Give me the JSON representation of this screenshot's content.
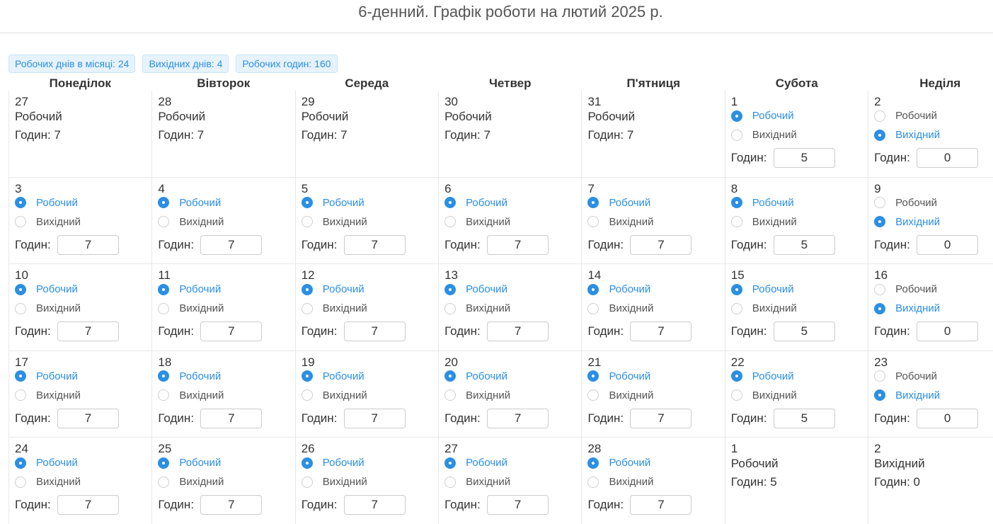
{
  "title": "6-денний. Графік роботи на лютий 2025 р.",
  "badges": [
    {
      "label": "Робочих днів в місяці: 24"
    },
    {
      "label": "Вихідних днів: 4"
    },
    {
      "label": "Робочих годин: 160"
    }
  ],
  "weekdays": [
    "Понеділок",
    "Вівторок",
    "Середа",
    "Четвер",
    "П'ятниця",
    "Субота",
    "Неділя"
  ],
  "labels": {
    "work": "Робочий",
    "off": "Вихідний",
    "hours": "Годин:"
  },
  "weeks": [
    [
      {
        "day": "27",
        "static": true,
        "type": "Робочий",
        "hours_text": "Годин: 7"
      },
      {
        "day": "28",
        "static": true,
        "type": "Робочий",
        "hours_text": "Годин: 7"
      },
      {
        "day": "29",
        "static": true,
        "type": "Робочий",
        "hours_text": "Годин: 7"
      },
      {
        "day": "30",
        "static": true,
        "type": "Робочий",
        "hours_text": "Годин: 7"
      },
      {
        "day": "31",
        "static": true,
        "type": "Робочий",
        "hours_text": "Годин: 7"
      },
      {
        "day": "1",
        "static": false,
        "working": true,
        "hours": "5"
      },
      {
        "day": "2",
        "static": false,
        "working": false,
        "hours": "0"
      }
    ],
    [
      {
        "day": "3",
        "static": false,
        "working": true,
        "hours": "7"
      },
      {
        "day": "4",
        "static": false,
        "working": true,
        "hours": "7"
      },
      {
        "day": "5",
        "static": false,
        "working": true,
        "hours": "7"
      },
      {
        "day": "6",
        "static": false,
        "working": true,
        "hours": "7"
      },
      {
        "day": "7",
        "static": false,
        "working": true,
        "hours": "7"
      },
      {
        "day": "8",
        "static": false,
        "working": true,
        "hours": "5"
      },
      {
        "day": "9",
        "static": false,
        "working": false,
        "hours": "0"
      }
    ],
    [
      {
        "day": "10",
        "static": false,
        "working": true,
        "hours": "7"
      },
      {
        "day": "11",
        "static": false,
        "working": true,
        "hours": "7"
      },
      {
        "day": "12",
        "static": false,
        "working": true,
        "hours": "7"
      },
      {
        "day": "13",
        "static": false,
        "working": true,
        "hours": "7"
      },
      {
        "day": "14",
        "static": false,
        "working": true,
        "hours": "7"
      },
      {
        "day": "15",
        "static": false,
        "working": true,
        "hours": "5"
      },
      {
        "day": "16",
        "static": false,
        "working": false,
        "hours": "0"
      }
    ],
    [
      {
        "day": "17",
        "static": false,
        "working": true,
        "hours": "7"
      },
      {
        "day": "18",
        "static": false,
        "working": true,
        "hours": "7"
      },
      {
        "day": "19",
        "static": false,
        "working": true,
        "hours": "7"
      },
      {
        "day": "20",
        "static": false,
        "working": true,
        "hours": "7"
      },
      {
        "day": "21",
        "static": false,
        "working": true,
        "hours": "7"
      },
      {
        "day": "22",
        "static": false,
        "working": true,
        "hours": "5"
      },
      {
        "day": "23",
        "static": false,
        "working": false,
        "hours": "0"
      }
    ],
    [
      {
        "day": "24",
        "static": false,
        "working": true,
        "hours": "7"
      },
      {
        "day": "25",
        "static": false,
        "working": true,
        "hours": "7"
      },
      {
        "day": "26",
        "static": false,
        "working": true,
        "hours": "7"
      },
      {
        "day": "27",
        "static": false,
        "working": true,
        "hours": "7"
      },
      {
        "day": "28",
        "static": false,
        "working": true,
        "hours": "7"
      },
      {
        "day": "1",
        "static": true,
        "type": "Робочий",
        "hours_text": "Годин: 5"
      },
      {
        "day": "2",
        "static": true,
        "type": "Вихідний",
        "hours_text": "Годин: 0"
      }
    ]
  ],
  "colors": {
    "accent": "#2b8fe4",
    "badge_bg": "#e6f3fd"
  }
}
